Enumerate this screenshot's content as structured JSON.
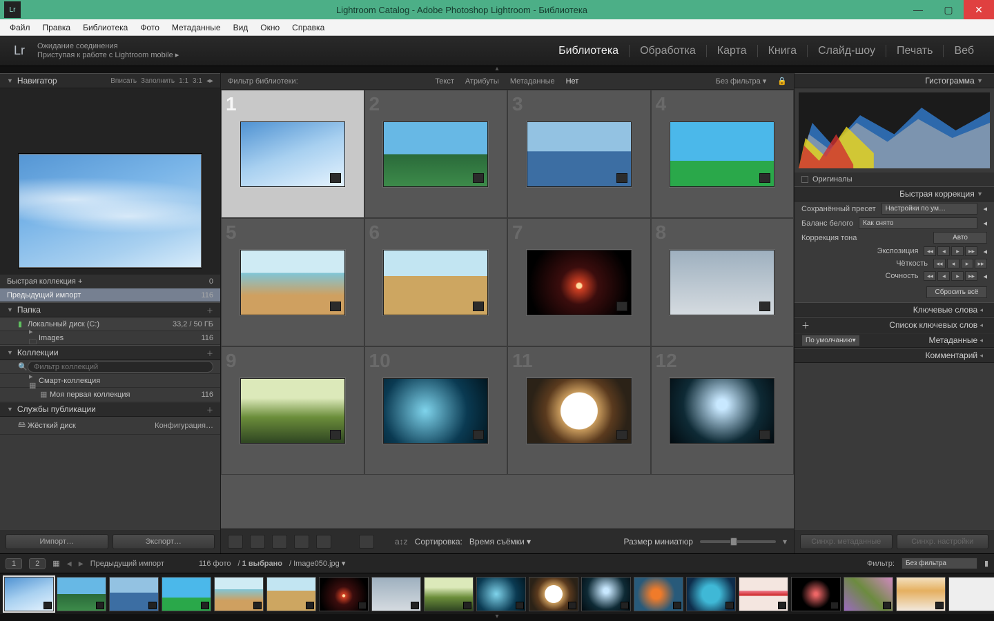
{
  "titlebar": {
    "title": "Lightroom Catalog - Adobe Photoshop Lightroom - Библиотека"
  },
  "menu": [
    "Файл",
    "Правка",
    "Библиотека",
    "Фото",
    "Метаданные",
    "Вид",
    "Окно",
    "Справка"
  ],
  "header": {
    "connecting": "Ожидание соединения",
    "mobile": "Приступая к работе с Lightroom mobile"
  },
  "modules": [
    "Библиотека",
    "Обработка",
    "Карта",
    "Книга",
    "Слайд-шоу",
    "Печать",
    "Веб"
  ],
  "module_active": 0,
  "navigator": {
    "title": "Навигатор",
    "opts": [
      "Вписать",
      "Заполнить",
      "1:1",
      "3:1"
    ]
  },
  "catalog": {
    "quick": "Быстрая коллекция  +",
    "quick_cnt": "0",
    "prev": "Предыдущий импорт",
    "prev_cnt": "116"
  },
  "folder": {
    "title": "Папка",
    "disk": "Локальный диск (C:)",
    "disk_used": "33,2 / 50 ГБ",
    "images": "Images",
    "images_cnt": "116"
  },
  "collections": {
    "title": "Коллекции",
    "filter_ph": "Фильтр коллекций",
    "smart": "Смарт-коллекция",
    "my": "Моя первая коллекция",
    "my_cnt": "116"
  },
  "publish": {
    "title": "Службы публикации",
    "hd": "Жёсткий диск",
    "cfg": "Конфигурация…"
  },
  "lbtn": {
    "import": "Импорт…",
    "export": "Экспорт…"
  },
  "filterbar": {
    "label": "Фильтр библиотеки:",
    "text": "Текст",
    "attr": "Атрибуты",
    "meta": "Метаданные",
    "none": "Нет",
    "nofilter": "Без фильтра"
  },
  "sort": {
    "label": "Сортировка:",
    "value": "Время съёмки"
  },
  "thumbsize": "Размер миниатюр",
  "right": {
    "histo": "Гистограмма",
    "originals": "Оригиналы",
    "quick": "Быстрая коррекция",
    "preset_lbl": "Сохранённый пресет",
    "preset_val": "Настройки по ум…",
    "wb_lbl": "Баланс белого",
    "wb_val": "Как снято",
    "tone_lbl": "Коррекция тона",
    "auto": "Авто",
    "expo": "Экспозиция",
    "clarity": "Чёткость",
    "vibr": "Сочность",
    "reset": "Сбросить всё",
    "keywords": "Ключевые слова",
    "kwlist": "Список ключевых слов",
    "meta": "Метаданные",
    "meta_preset": "По умолчанию",
    "comment": "Комментарий"
  },
  "rbtn": {
    "sync_meta": "Синхр. метаданные",
    "sync_set": "Синхр. настройки"
  },
  "status": {
    "pages": [
      "1",
      "2"
    ],
    "crumb": "Предыдущий импорт",
    "count": "116 фото",
    "sel": "1 выбрано",
    "file": "Image050.jpg",
    "filter_lbl": "Фильтр:",
    "filter_val": "Без фильтра"
  },
  "grid_cells": [
    1,
    2,
    3,
    4,
    5,
    6,
    7,
    8,
    9,
    10,
    11,
    12
  ]
}
